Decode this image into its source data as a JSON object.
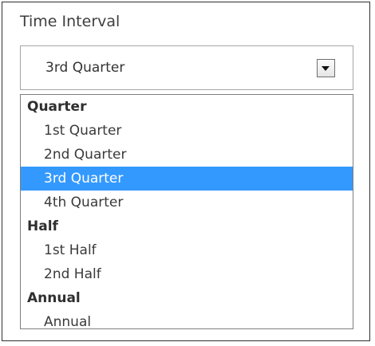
{
  "field": {
    "label": "Time Interval",
    "selected_value": "3rd Quarter"
  },
  "dropdown": {
    "groups": [
      {
        "label": "Quarter",
        "options": [
          "1st Quarter",
          "2nd Quarter",
          "3rd Quarter",
          "4th Quarter"
        ]
      },
      {
        "label": "Half",
        "options": [
          "1st Half",
          "2nd Half"
        ]
      },
      {
        "label": "Annual",
        "options": [
          "Annual"
        ]
      }
    ]
  },
  "colors": {
    "selected_background": "#3399ff",
    "selected_text": "#ffffff",
    "border": "#a6a6a6",
    "text": "#3a3a3a"
  },
  "icons": {
    "dropdown": "chevron-down-icon"
  }
}
